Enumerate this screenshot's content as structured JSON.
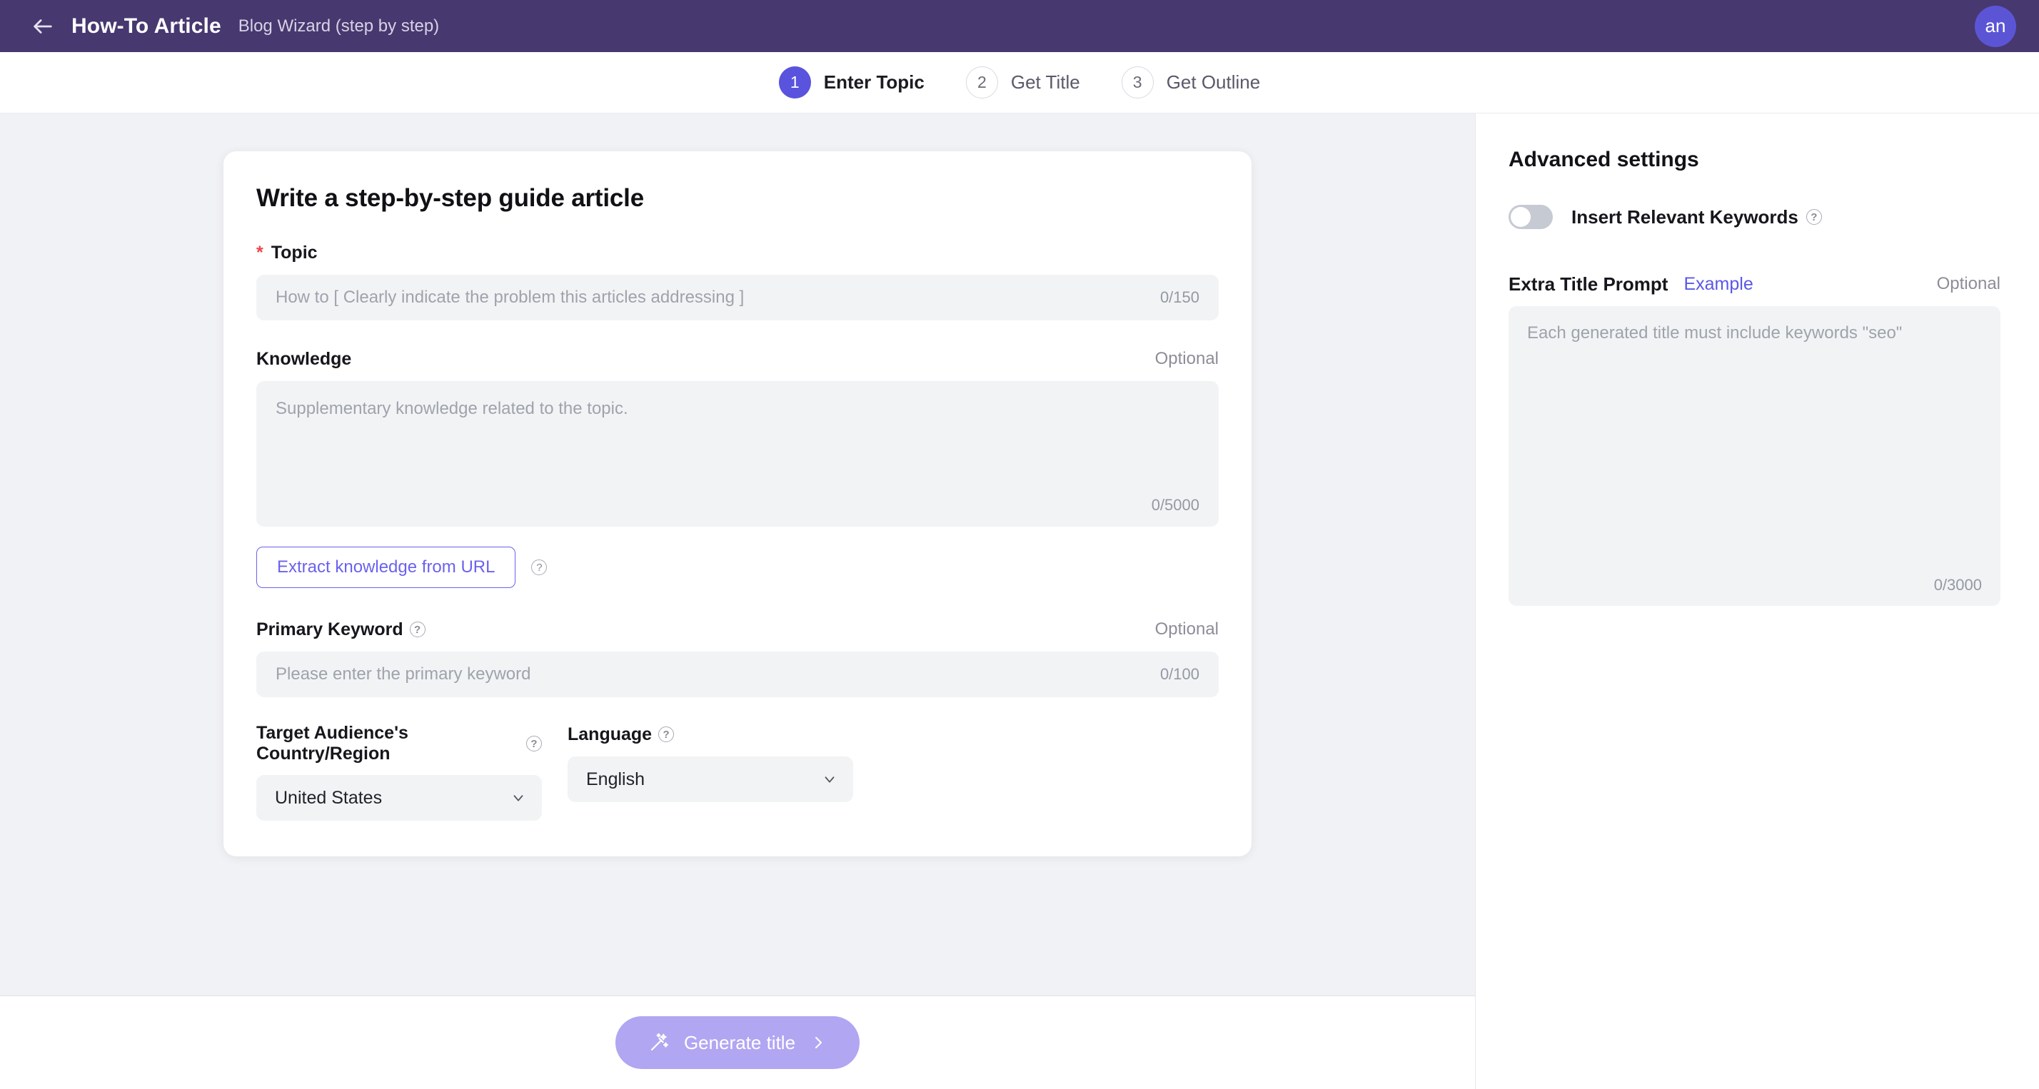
{
  "header": {
    "back_icon": "arrow-left-icon",
    "title": "How-To Article",
    "subtitle": "Blog Wizard (step by step)",
    "avatar_initials": "an",
    "bar_color": "#473870",
    "avatar_color": "#5b55d6"
  },
  "stepper": {
    "steps": [
      {
        "number": "1",
        "label": "Enter Topic",
        "active": true
      },
      {
        "number": "2",
        "label": "Get Title",
        "active": false
      },
      {
        "number": "3",
        "label": "Get Outline",
        "active": false
      }
    ],
    "active_color": "#5953dd"
  },
  "form": {
    "card_title": "Write a step-by-step guide article",
    "topic": {
      "label": "Topic",
      "required_mark": "*",
      "placeholder": "How to [ Clearly indicate the problem this articles addressing ]",
      "value": "",
      "counter": "0/150"
    },
    "knowledge": {
      "label": "Knowledge",
      "optional": "Optional",
      "placeholder": "Supplementary knowledge related to the topic.",
      "value": "",
      "counter": "0/5000"
    },
    "extract_button": {
      "label": "Extract knowledge from URL",
      "help_icon": "question-circle-icon",
      "color": "#6a62ee"
    },
    "primary_keyword": {
      "label": "Primary Keyword",
      "help_icon": "question-circle-icon",
      "optional": "Optional",
      "placeholder": "Please enter the primary keyword",
      "value": "",
      "counter": "0/100"
    },
    "country": {
      "label": "Target Audience's Country/Region",
      "help_icon": "question-circle-icon",
      "value": "United States",
      "chevron": "chevron-down-icon"
    },
    "language": {
      "label": "Language",
      "help_icon": "question-circle-icon",
      "value": "English",
      "chevron": "chevron-down-icon"
    }
  },
  "advanced": {
    "title": "Advanced settings",
    "insert_keywords": {
      "label": "Insert Relevant Keywords",
      "help_icon": "question-circle-icon",
      "enabled": false
    },
    "extra_title_prompt": {
      "label": "Extra Title Prompt",
      "example_link": "Example",
      "optional": "Optional",
      "placeholder": "Each generated title must include keywords \"seo\"",
      "value": "",
      "counter": "0/3000",
      "link_color": "#5b57e8"
    }
  },
  "footer": {
    "generate_button": {
      "label": "Generate title",
      "leading_icon": "magic-wand-icon",
      "trailing_icon": "chevron-right-icon",
      "color": "#b1a6f2",
      "disabled": true
    }
  }
}
